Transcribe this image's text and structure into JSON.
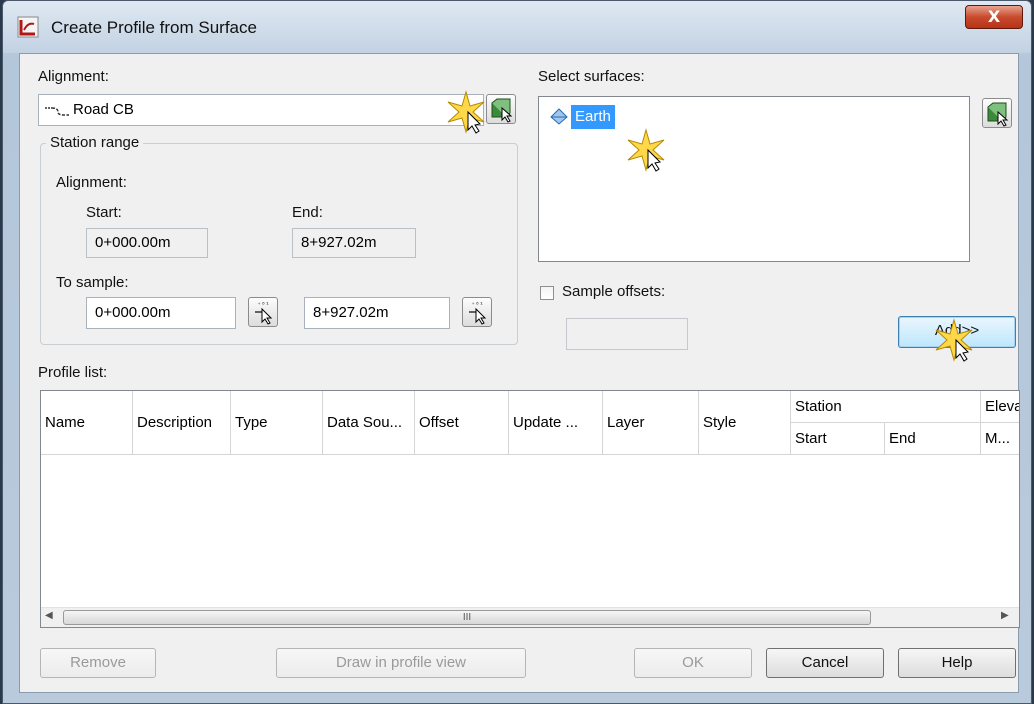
{
  "dialog": {
    "title": "Create Profile from Surface",
    "close_glyph": "X"
  },
  "alignment": {
    "label": "Alignment:",
    "value": "Road CB"
  },
  "station_range": {
    "group_label": "Station range",
    "alignment_label": "Alignment:",
    "start_label": "Start:",
    "end_label": "End:",
    "start_value": "0+000.00m",
    "end_value": "8+927.02m",
    "to_sample_label": "To sample:",
    "sample_start": "0+000.00m",
    "sample_end": "8+927.02m"
  },
  "surfaces": {
    "label": "Select surfaces:",
    "items": [
      "Earth"
    ]
  },
  "sample_offsets": {
    "label": "Sample offsets:",
    "checked": false,
    "value": ""
  },
  "add_button": {
    "label": "Add>>"
  },
  "profile_list": {
    "label": "Profile list:",
    "columns": [
      "Name",
      "Description",
      "Type",
      "Data Sou...",
      "Offset",
      "Update ...",
      "Layer",
      "Style"
    ],
    "station_group": "Station",
    "station_sub": [
      "Start",
      "End"
    ],
    "elevation_group": "Eleva",
    "elevation_sub": [
      "M..."
    ],
    "rows": [],
    "scroll_grip": "III"
  },
  "buttons": {
    "remove": "Remove",
    "draw": "Draw in profile view",
    "ok": "OK",
    "cancel": "Cancel",
    "help": "Help"
  },
  "colors": {
    "selection": "#3399ff",
    "title_bar": "#c2d2e3",
    "close_button": "#c84b2e"
  }
}
